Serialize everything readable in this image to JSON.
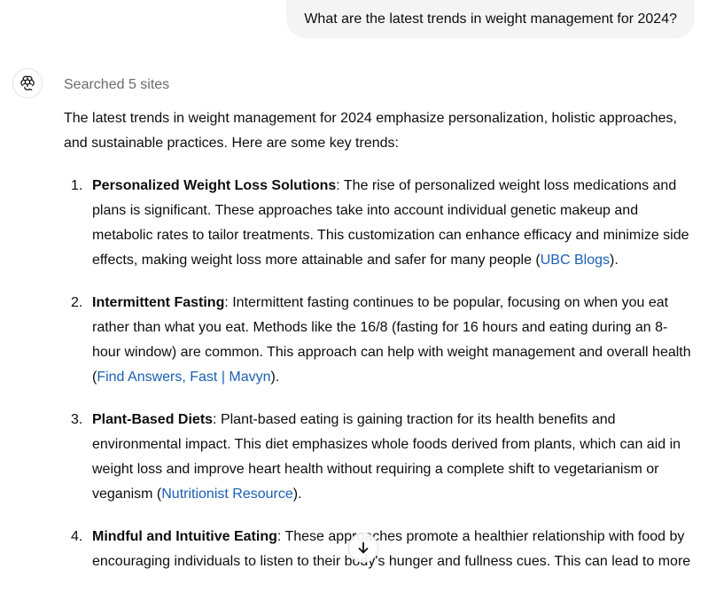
{
  "user_message": "What are the latest trends in weight management for 2024?",
  "assistant": {
    "logo_icon": "openai-logo-icon",
    "searched_label": "Searched 5 sites",
    "intro": "The latest trends in weight management for 2024 emphasize personalization, holistic approaches, and sustainable practices. Here are some key trends:",
    "items": [
      {
        "number": "1.",
        "title": "Personalized Weight Loss Solutions",
        "text": ": The rise of personalized weight loss medications and plans is significant. These approaches take into account individual genetic makeup and metabolic rates to tailor treatments. This customization can enhance efficacy and minimize side effects, making weight loss more attainable and safer for many people ",
        "source": "UBC Blogs",
        "after": "."
      },
      {
        "number": "2.",
        "title": "Intermittent Fasting",
        "text": ": Intermittent fasting continues to be popular, focusing on when you eat rather than what you eat. Methods like the 16/8 (fasting for 16 hours and eating during an 8-hour window) are common. This approach can help with weight management and overall health ",
        "source": "Find Answers, Fast | Mavyn",
        "after": "."
      },
      {
        "number": "3.",
        "title": "Plant-Based Diets",
        "text": ": Plant-based eating is gaining traction for its health benefits and environmental impact. This diet emphasizes whole foods derived from plants, which can aid in weight loss and improve heart health without requiring a complete shift to vegetarianism or veganism ",
        "source": "Nutritionist Resource",
        "after": "."
      },
      {
        "number": "4.",
        "title": "Mindful and Intuitive Eating",
        "text": ": These approaches promote a healthier relationship with food by encouraging individuals to listen to their body's hunger and fullness cues. This can lead to more",
        "source": "",
        "after": ""
      }
    ]
  },
  "scroll_down_icon": "arrow-down-icon"
}
